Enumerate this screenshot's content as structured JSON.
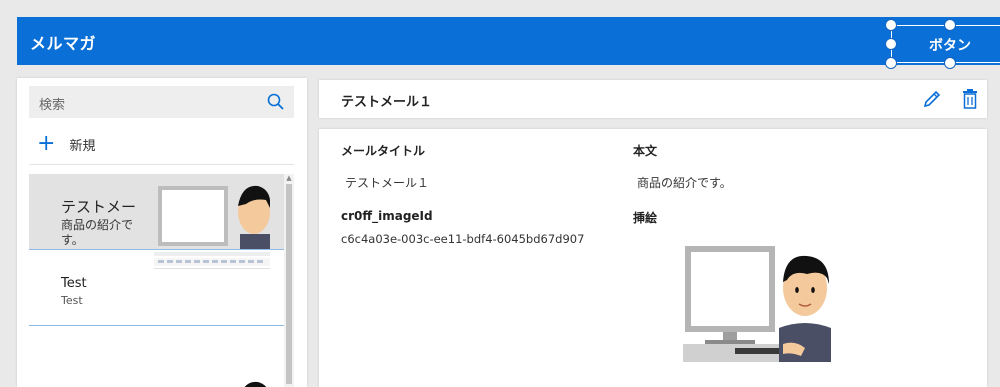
{
  "header": {
    "title": "メルマガ",
    "button_label": "ボタン",
    "color": "#0a6fd6"
  },
  "sidebar": {
    "search_placeholder": "検索",
    "new_label": "新規",
    "items": [
      {
        "title": "テストメー",
        "subtitle": "商品の紹介で",
        "subtitle2": "す。",
        "image": "person-at-computer-illustration"
      },
      {
        "title": "Test",
        "subtitle": "Test",
        "image": "document-editor-screenshot"
      },
      {
        "title": "",
        "subtitle": "",
        "image": "person-at-computer-illustration"
      }
    ]
  },
  "detail": {
    "header_title": "テストメール１",
    "fields": {
      "mail_title_label": "メールタイトル",
      "mail_title_value": "テストメール１",
      "body_label": "本文",
      "body_value": "商品の紹介です。",
      "image_id_label": "cr0ff_imageId",
      "image_id_value": "c6c4a03e-003c-ee11-bdf4-6045bd67d907",
      "illustration_label": "挿絵"
    }
  },
  "icons": {
    "search": "search-icon",
    "add": "plus-icon",
    "edit": "pencil-icon",
    "delete": "trash-icon"
  }
}
